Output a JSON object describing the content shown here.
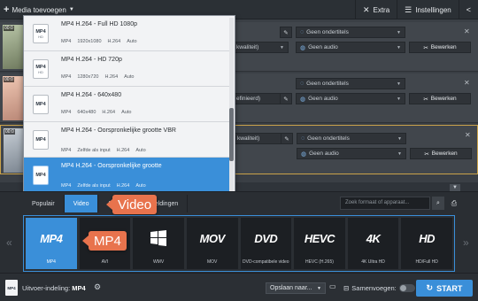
{
  "toolbar": {
    "add_media_label": "Media toevoegen",
    "extra_label": "Extra",
    "settings_label": "Instellingen",
    "share_icon": "share-icon"
  },
  "files": [
    {
      "duration": "00:0",
      "quality": "kwaliteit)",
      "subtitles": "Geen ondertitels",
      "audio": "Geen audio",
      "edit": "Bewerken"
    },
    {
      "duration": "00:0",
      "quality": "efinieerd)",
      "subtitles": "Geen ondertitels",
      "audio": "Geen audio",
      "edit": "Bewerken"
    },
    {
      "duration": "00:0",
      "quality": "kwaliteit)",
      "subtitles": "Geen ondertitels",
      "audio": "Geen audio",
      "edit": "Bewerken"
    }
  ],
  "presets": [
    {
      "name": "MP4 H.264 - Full HD 1080p",
      "icon_tag": "HD",
      "specs": [
        "MP4",
        "1920x1080",
        "H.264",
        "Auto"
      ],
      "selected": false
    },
    {
      "name": "MP4 H.264 - HD 720p",
      "icon_tag": "HD",
      "specs": [
        "MP4",
        "1280x720",
        "H.264",
        "Auto"
      ],
      "selected": false
    },
    {
      "name": "MP4 H.264 - 640x480",
      "icon_tag": "",
      "specs": [
        "MP4",
        "640x480",
        "H.264",
        "Auto"
      ],
      "selected": false
    },
    {
      "name": "MP4 H.264 - Oorspronkelijke grootte VBR",
      "icon_tag": "",
      "specs": [
        "MP4",
        "Zelfde als input",
        "H.264",
        "Auto"
      ],
      "selected": false
    },
    {
      "name": "MP4 H.264 - Oorspronkelijke grootte",
      "icon_tag": "",
      "specs": [
        "MP4",
        "Zelfde als input",
        "H.264",
        "Auto"
      ],
      "selected": true
    }
  ],
  "format_tabs": [
    "Populair",
    "Video",
    "Audio",
    "Afbeeldingen"
  ],
  "active_tab": "Video",
  "search_placeholder": "Zoek formaat of apparaat...",
  "formats": [
    {
      "logo": "MP4",
      "label": "MP4"
    },
    {
      "logo": "AVI",
      "label": "AVI"
    },
    {
      "logo": "WMV",
      "label": "WMV"
    },
    {
      "logo": "MOV",
      "label": "MOV"
    },
    {
      "logo": "DVD",
      "label": "DVD-compatibele video"
    },
    {
      "logo": "HEVC",
      "label": "HEVC (H.265)"
    },
    {
      "logo": "4K",
      "label": "4K Ultra HD"
    },
    {
      "logo": "HD",
      "label": "HD/Full HD"
    }
  ],
  "callouts": {
    "tab": "Video",
    "format": "MP4"
  },
  "bottom": {
    "output_label": "Uitvoer-indeling:",
    "output_value": "MP4",
    "save_to": "Opslaan naar...",
    "merge": "Samenvoegen:",
    "start": "START"
  }
}
